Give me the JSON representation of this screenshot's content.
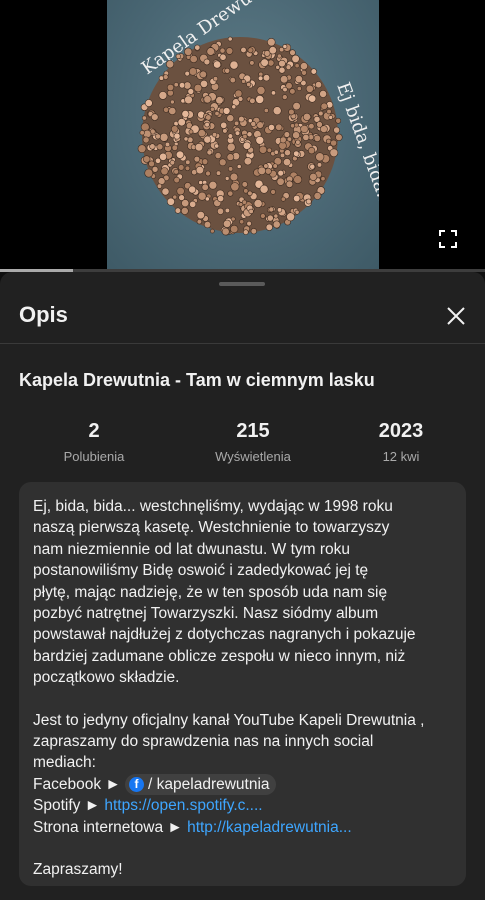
{
  "player": {
    "cover": {
      "title_text": "Kapela Drewutnia",
      "subtitle_text": "Ej bida, bida...",
      "bg_color": "#4a6774"
    },
    "progress": 0.15,
    "fullscreen_icon": "fullscreen-icon"
  },
  "sheet": {
    "title": "Opis",
    "close_icon": "close-icon"
  },
  "video": {
    "title": "Kapela Drewutnia - Tam w ciemnym lasku",
    "stats": [
      {
        "value": "2",
        "label": "Polubienia"
      },
      {
        "value": "215",
        "label": "Wyświetlenia"
      },
      {
        "value": "2023",
        "label": "12 kwi"
      }
    ]
  },
  "description": {
    "para1_lines": [
      "Ej, bida, bida... westchnęliśmy, wydając w 1998 roku",
      "naszą pierwszą kasetę. Westchnienie to towarzyszy",
      "nam niezmiennie od lat dwunastu. W tym roku",
      "postanowiliśmy Bidę oswoić i zadedykować jej tę",
      "płytę, mając nadzieję, że w ten sposób uda nam się",
      "pozbyć natrętnej Towarzyszki. Nasz siódmy album",
      "powstawał najdłużej z dotychczas nagranych i pokazuje",
      "bardziej zadumane oblicze zespołu w nieco innym, niż",
      "początkowo składzie."
    ],
    "para2_lines": [
      "Jest to jedyny oficjalny kanał YouTube Kapeli Drewutnia ,",
      "zapraszamy do sprawdzenia nas na innych social",
      "mediach:"
    ],
    "facebook_label": "Facebook ►",
    "facebook_link": "/ kapeladrewutnia",
    "spotify_label": "Spotify ►",
    "spotify_link": "https://open.spotify.c....",
    "website_label": "Strona internetowa ►",
    "website_link": "http://kapeladrewutnia...",
    "closing": "Zapraszamy!"
  },
  "colors": {
    "background": "#0f0f0f",
    "sheet": "#212121",
    "desc_box": "#303030",
    "link": "#3ea6ff",
    "facebook": "#1877f2"
  }
}
